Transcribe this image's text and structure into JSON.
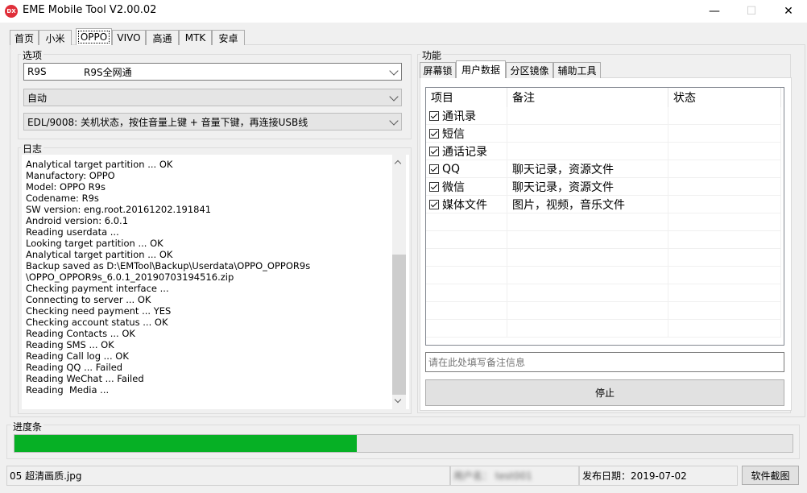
{
  "window": {
    "title": "EME Mobile Tool V2.00.02",
    "icon_text": "DX",
    "minimize": "—",
    "maximize": "☐",
    "close": "✕"
  },
  "tabs": [
    "首页",
    "小米",
    "OPPO",
    "VIVO",
    "高通",
    "MTK",
    "安卓"
  ],
  "active_tab": "OPPO",
  "options": {
    "label": "选项",
    "model": "R9S",
    "model_desc": "R9S全网通",
    "mode": "自动",
    "edl_hint": "EDL/9008: 关机状态，按住音量上键 + 音量下键，再连接USB线"
  },
  "log": {
    "label": "日志",
    "lines": [
      "Analytical target partition ... OK",
      "Manufactory: OPPO",
      "Model: OPPO R9s",
      "Codename: R9s",
      "SW version: eng.root.20161202.191841",
      "Android version: 6.0.1",
      "Reading userdata ...",
      "Looking target partition ... OK",
      "Analytical target partition ... OK",
      "Backup saved as D:\\EMTool\\Backup\\Userdata\\OPPO_OPPOR9s",
      "\\OPPO_OPPOR9s_6.0.1_20190703194516.zip",
      "Checking payment interface ...",
      "Connecting to server ... OK",
      "Checking need payment ... YES",
      "Checking account status ... OK",
      "Reading Contacts ... OK",
      "Reading SMS ... OK",
      "Reading Call log ... OK",
      "Reading QQ ... Failed",
      "Reading WeChat ... Failed",
      "Reading  Media ..."
    ]
  },
  "function": {
    "label": "功能",
    "tabs": [
      "屏幕锁",
      "用户数据",
      "分区镜像",
      "辅助工具"
    ],
    "active_tab": "用户数据",
    "columns": [
      "项目",
      "备注",
      "状态"
    ],
    "rows": [
      {
        "item": "通讯录",
        "note": "",
        "status": "",
        "checked": true
      },
      {
        "item": "短信",
        "note": "",
        "status": "",
        "checked": true
      },
      {
        "item": "通话记录",
        "note": "",
        "status": "",
        "checked": true
      },
      {
        "item": "QQ",
        "note": "聊天记录，资源文件",
        "status": "",
        "checked": true
      },
      {
        "item": "微信",
        "note": "聊天记录，资源文件",
        "status": "",
        "checked": true
      },
      {
        "item": "媒体文件",
        "note": "图片，视频，音乐文件",
        "status": "",
        "checked": true
      }
    ],
    "note_placeholder": "请在此处填写备注信息",
    "stop_label": "停止"
  },
  "progress": {
    "label": "进度条",
    "value": 0.44,
    "color": "#06b025"
  },
  "statusbar": {
    "file": "05 超清画质.jpg",
    "user": "用户名：  test001",
    "release": "发布日期：2019-07-02",
    "screenshot_button": "软件截图"
  }
}
